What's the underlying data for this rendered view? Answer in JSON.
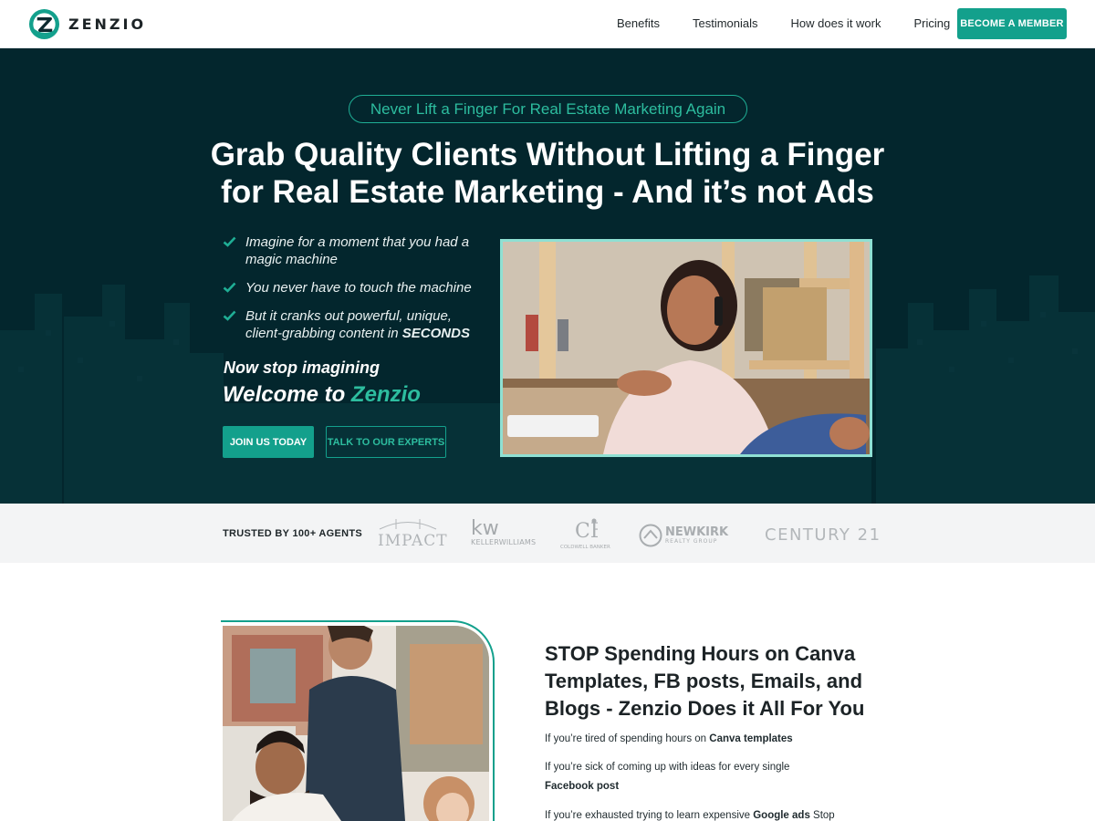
{
  "nav": {
    "logo_text": "ZENZIO",
    "links": [
      "Benefits",
      "Testimonials",
      "How does it work",
      "Pricing"
    ],
    "cta": "BECOME A MEMBER"
  },
  "hero": {
    "tagline": "Never Lift a Finger For Real Estate Marketing Again",
    "title_line1": "Grab Quality Clients Without Lifting a Finger",
    "title_line2": "for Real Estate Marketing - And it’s not Ads",
    "bullets": [
      {
        "text": "Imagine for a moment that you had a magic machine",
        "bold": ""
      },
      {
        "text": "You never have to touch the machine",
        "bold": ""
      },
      {
        "text": "But it cranks out powerful, unique, client-grabbing content in ",
        "bold": "SECONDS"
      }
    ],
    "stop_text": "Now stop imagining",
    "welcome_prefix": "Welcome to ",
    "welcome_brand": "Zenzio",
    "join_button": "JOIN US TODAY",
    "talk_button": "TALK TO OUR EXPERTS"
  },
  "trusted": {
    "label": "TRUSTED  BY 100+ AGENTS",
    "logos": {
      "impact": "IMPACT",
      "kw": "kw",
      "kw_sub": "KELLERWILLIAMS",
      "cb_sub": "COLDWELL BANKER",
      "newkirk": "NEWKIRK",
      "newkirk_sub": "REALTY GROUP",
      "century": "CENTURY 21"
    }
  },
  "section2": {
    "title": "STOP Spending Hours on Canva Templates, FB posts, Emails, and Blogs - Zenzio Does it All For You",
    "p1_text": "If you’re tired of spending hours on ",
    "p1_bold": "Canva templates",
    "p2_text": "If you’re sick of coming up with ideas for every single ",
    "p2_bold": "Facebook post",
    "p3_text": "If you’re exhausted trying to learn expensive ",
    "p3_bold": "Google ads",
    "p3_tail": " Stop"
  },
  "colors": {
    "accent": "#13a08c",
    "accent_text": "#2dbd9f",
    "hero_bg": "#03262d",
    "trusted_bg": "#f3f4f5"
  }
}
